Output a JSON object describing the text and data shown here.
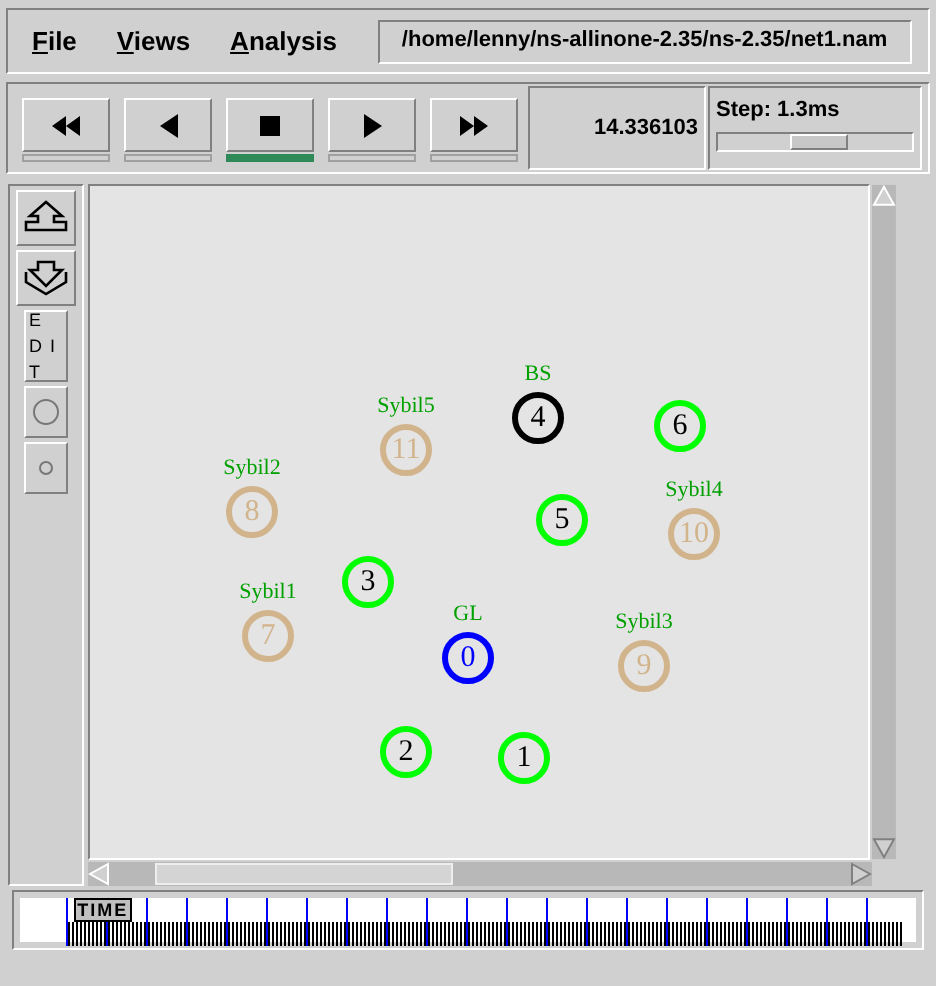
{
  "menu": [
    {
      "label": "File"
    },
    {
      "label": "Views"
    },
    {
      "label": "Analysis"
    }
  ],
  "file_path": "/home/lenny/ns-allinone-2.35/ns-2.35/net1.nam",
  "playback": [
    {
      "kind": "rewind",
      "selected": false
    },
    {
      "kind": "back",
      "selected": false
    },
    {
      "kind": "stop",
      "selected": true
    },
    {
      "kind": "play",
      "selected": false
    },
    {
      "kind": "forward",
      "selected": false
    }
  ],
  "time": "14.336103",
  "step": {
    "label": "Step: 1.3ms",
    "level": 0.52
  },
  "tools": [
    {
      "kind": "zoom_in"
    },
    {
      "kind": "zoom_out"
    },
    {
      "kind": "edit",
      "label": "EDIT"
    },
    {
      "kind": "large_circle"
    },
    {
      "kind": "small_circle"
    }
  ],
  "nodes": [
    {
      "id": "11",
      "label": "Sybil5",
      "color": "#d2b48c"
    },
    {
      "id": "4",
      "label": "BS",
      "color": "#000000"
    },
    {
      "id": "6",
      "color": "#00ff00"
    },
    {
      "id": "8",
      "label": "Sybil2",
      "color": "#d2b48c"
    },
    {
      "id": "5",
      "color": "#00ff00"
    },
    {
      "id": "10",
      "label": "Sybil4",
      "color": "#d2b48c"
    },
    {
      "id": "7",
      "label": "Sybil1",
      "color": "#d2b48c"
    },
    {
      "id": "3",
      "color": "#00ff00"
    },
    {
      "id": "0",
      "label": "GL",
      "color": "#0000ff"
    },
    {
      "id": "9",
      "label": "Sybil3",
      "color": "#d2b48c"
    },
    {
      "id": "2",
      "color": "#00ff00"
    },
    {
      "id": "1",
      "color": "#00ff00"
    }
  ],
  "timeline": {
    "label": "TIME",
    "level": 0.03
  }
}
